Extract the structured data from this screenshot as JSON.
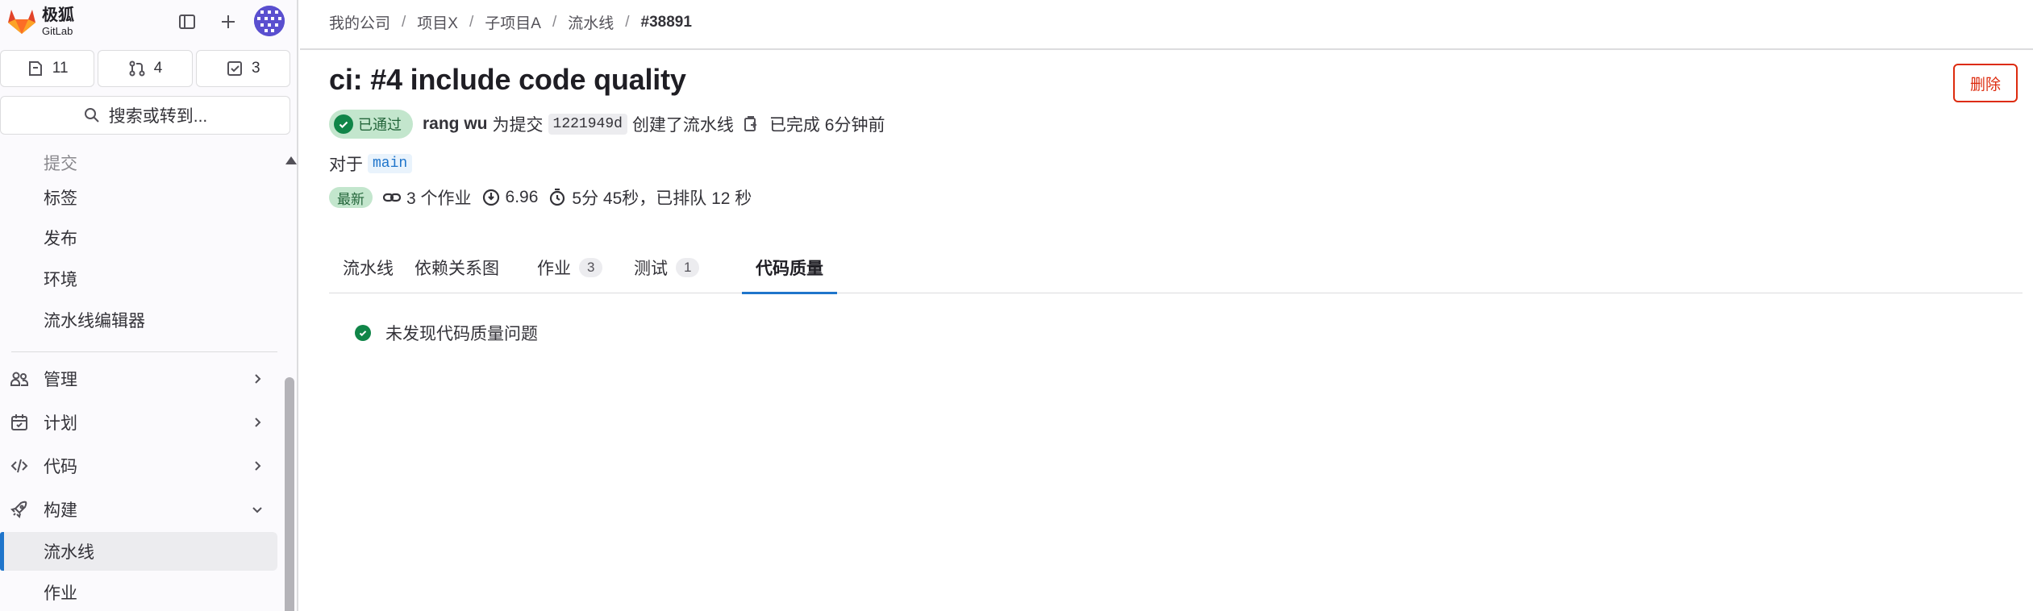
{
  "brand": {
    "name": "极狐",
    "sub": "GitLab"
  },
  "colors": {
    "accent": "#1f75cb",
    "success": "#108548",
    "danger": "#dd2b0e",
    "logo": "#e24329"
  },
  "sidebar": {
    "counters": [
      {
        "icon": "issues-icon",
        "count": "11"
      },
      {
        "icon": "merge-request-icon",
        "count": "4"
      },
      {
        "icon": "todo-icon",
        "count": "3"
      }
    ],
    "search_label": "搜索或转到...",
    "items": [
      {
        "label": "提交"
      },
      {
        "label": "标签"
      },
      {
        "label": "发布"
      },
      {
        "label": "环境"
      },
      {
        "label": "流水线编辑器"
      },
      {
        "label": "管理",
        "icon": "users-icon"
      },
      {
        "label": "计划",
        "icon": "calendar-icon"
      },
      {
        "label": "代码",
        "icon": "code-icon"
      },
      {
        "label": "构建",
        "icon": "rocket-icon"
      },
      {
        "label": "流水线"
      },
      {
        "label": "作业"
      }
    ]
  },
  "breadcrumb": [
    "我的公司",
    "项目X",
    "子项目A",
    "流水线",
    "#38891"
  ],
  "pipeline": {
    "title": "ci: #4 include code quality",
    "delete_label": "删除",
    "status": "已通过",
    "author": "rang wu",
    "for_commit": "为提交",
    "sha": "1221949d",
    "created": "创建了流水线",
    "finished": "已完成 6分钟前",
    "for_label": "对于",
    "branch": "main",
    "latest": "最新",
    "jobs": "3 个作业",
    "compute": "6.96",
    "duration": "5分 45秒，已排队 12 秒"
  },
  "tabs": [
    {
      "label": "流水线"
    },
    {
      "label": "依赖关系图"
    },
    {
      "label": "作业",
      "count": "3"
    },
    {
      "label": "测试",
      "count": "1"
    },
    {
      "label": "代码质量"
    }
  ],
  "code_quality": {
    "message": "未发现代码质量问题"
  }
}
